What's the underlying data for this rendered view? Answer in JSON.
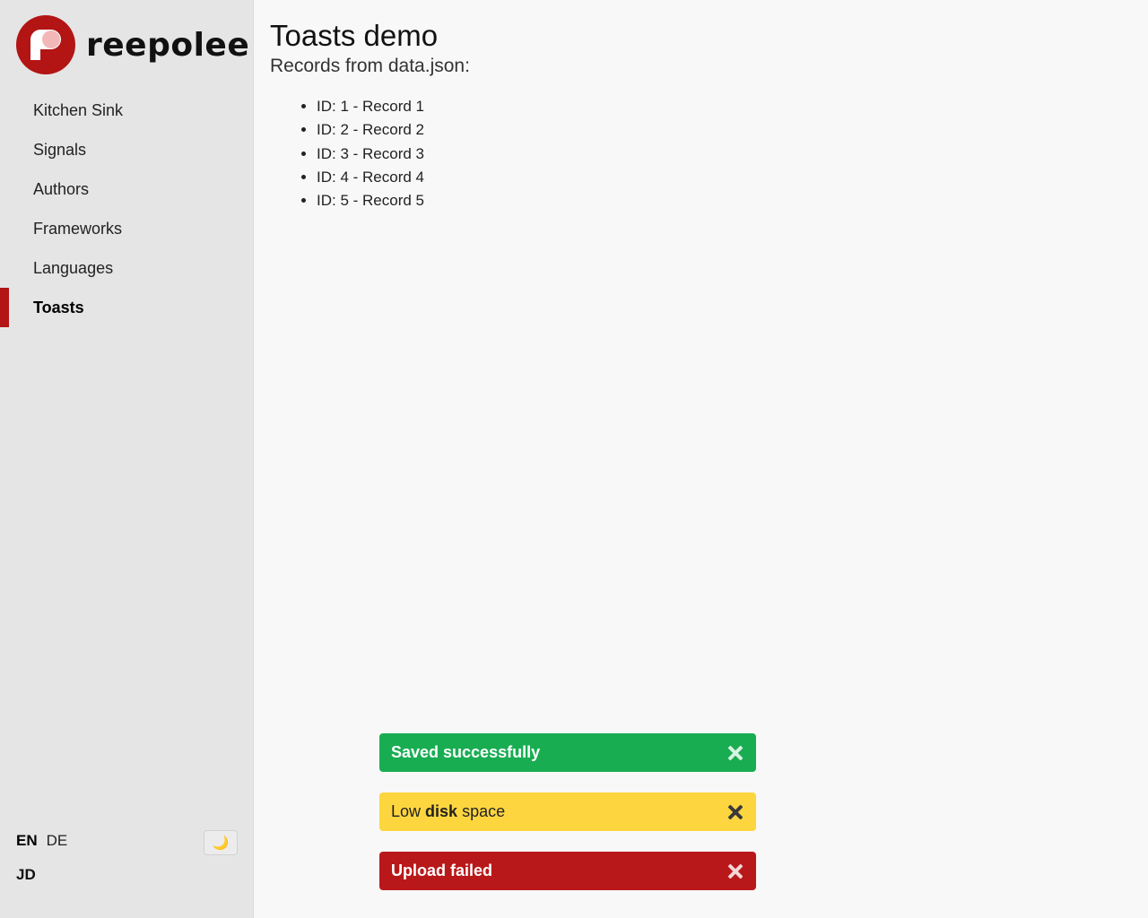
{
  "brand": {
    "name": "reepolee",
    "colors": {
      "primary": "#b31414",
      "highlight": "#f2b8b8"
    }
  },
  "sidebar": {
    "items": [
      {
        "label": "Kitchen Sink"
      },
      {
        "label": "Signals"
      },
      {
        "label": "Authors"
      },
      {
        "label": "Frameworks"
      },
      {
        "label": "Languages"
      },
      {
        "label": "Toasts",
        "active": true
      }
    ],
    "languages": [
      {
        "label": "EN",
        "active": true
      },
      {
        "label": "DE",
        "active": false
      }
    ],
    "theme_toggle_icon": "moon-icon",
    "user_initials": "JD"
  },
  "main": {
    "title": "Toasts demo",
    "subtitle": "Records from data.json:",
    "records": [
      "ID: 1 - Record 1",
      "ID: 2 - Record 2",
      "ID: 3 - Record 3",
      "ID: 4 - Record 4",
      "ID: 5 - Record 5"
    ]
  },
  "toasts": [
    {
      "type": "success",
      "message": "Saved successfully",
      "color": "#19ad52"
    },
    {
      "type": "warning",
      "message_prefix": "Low ",
      "message_bold": "disk",
      "message_suffix": " space",
      "color": "#fdd63f"
    },
    {
      "type": "error",
      "message": "Upload failed",
      "color": "#b9181a"
    }
  ]
}
